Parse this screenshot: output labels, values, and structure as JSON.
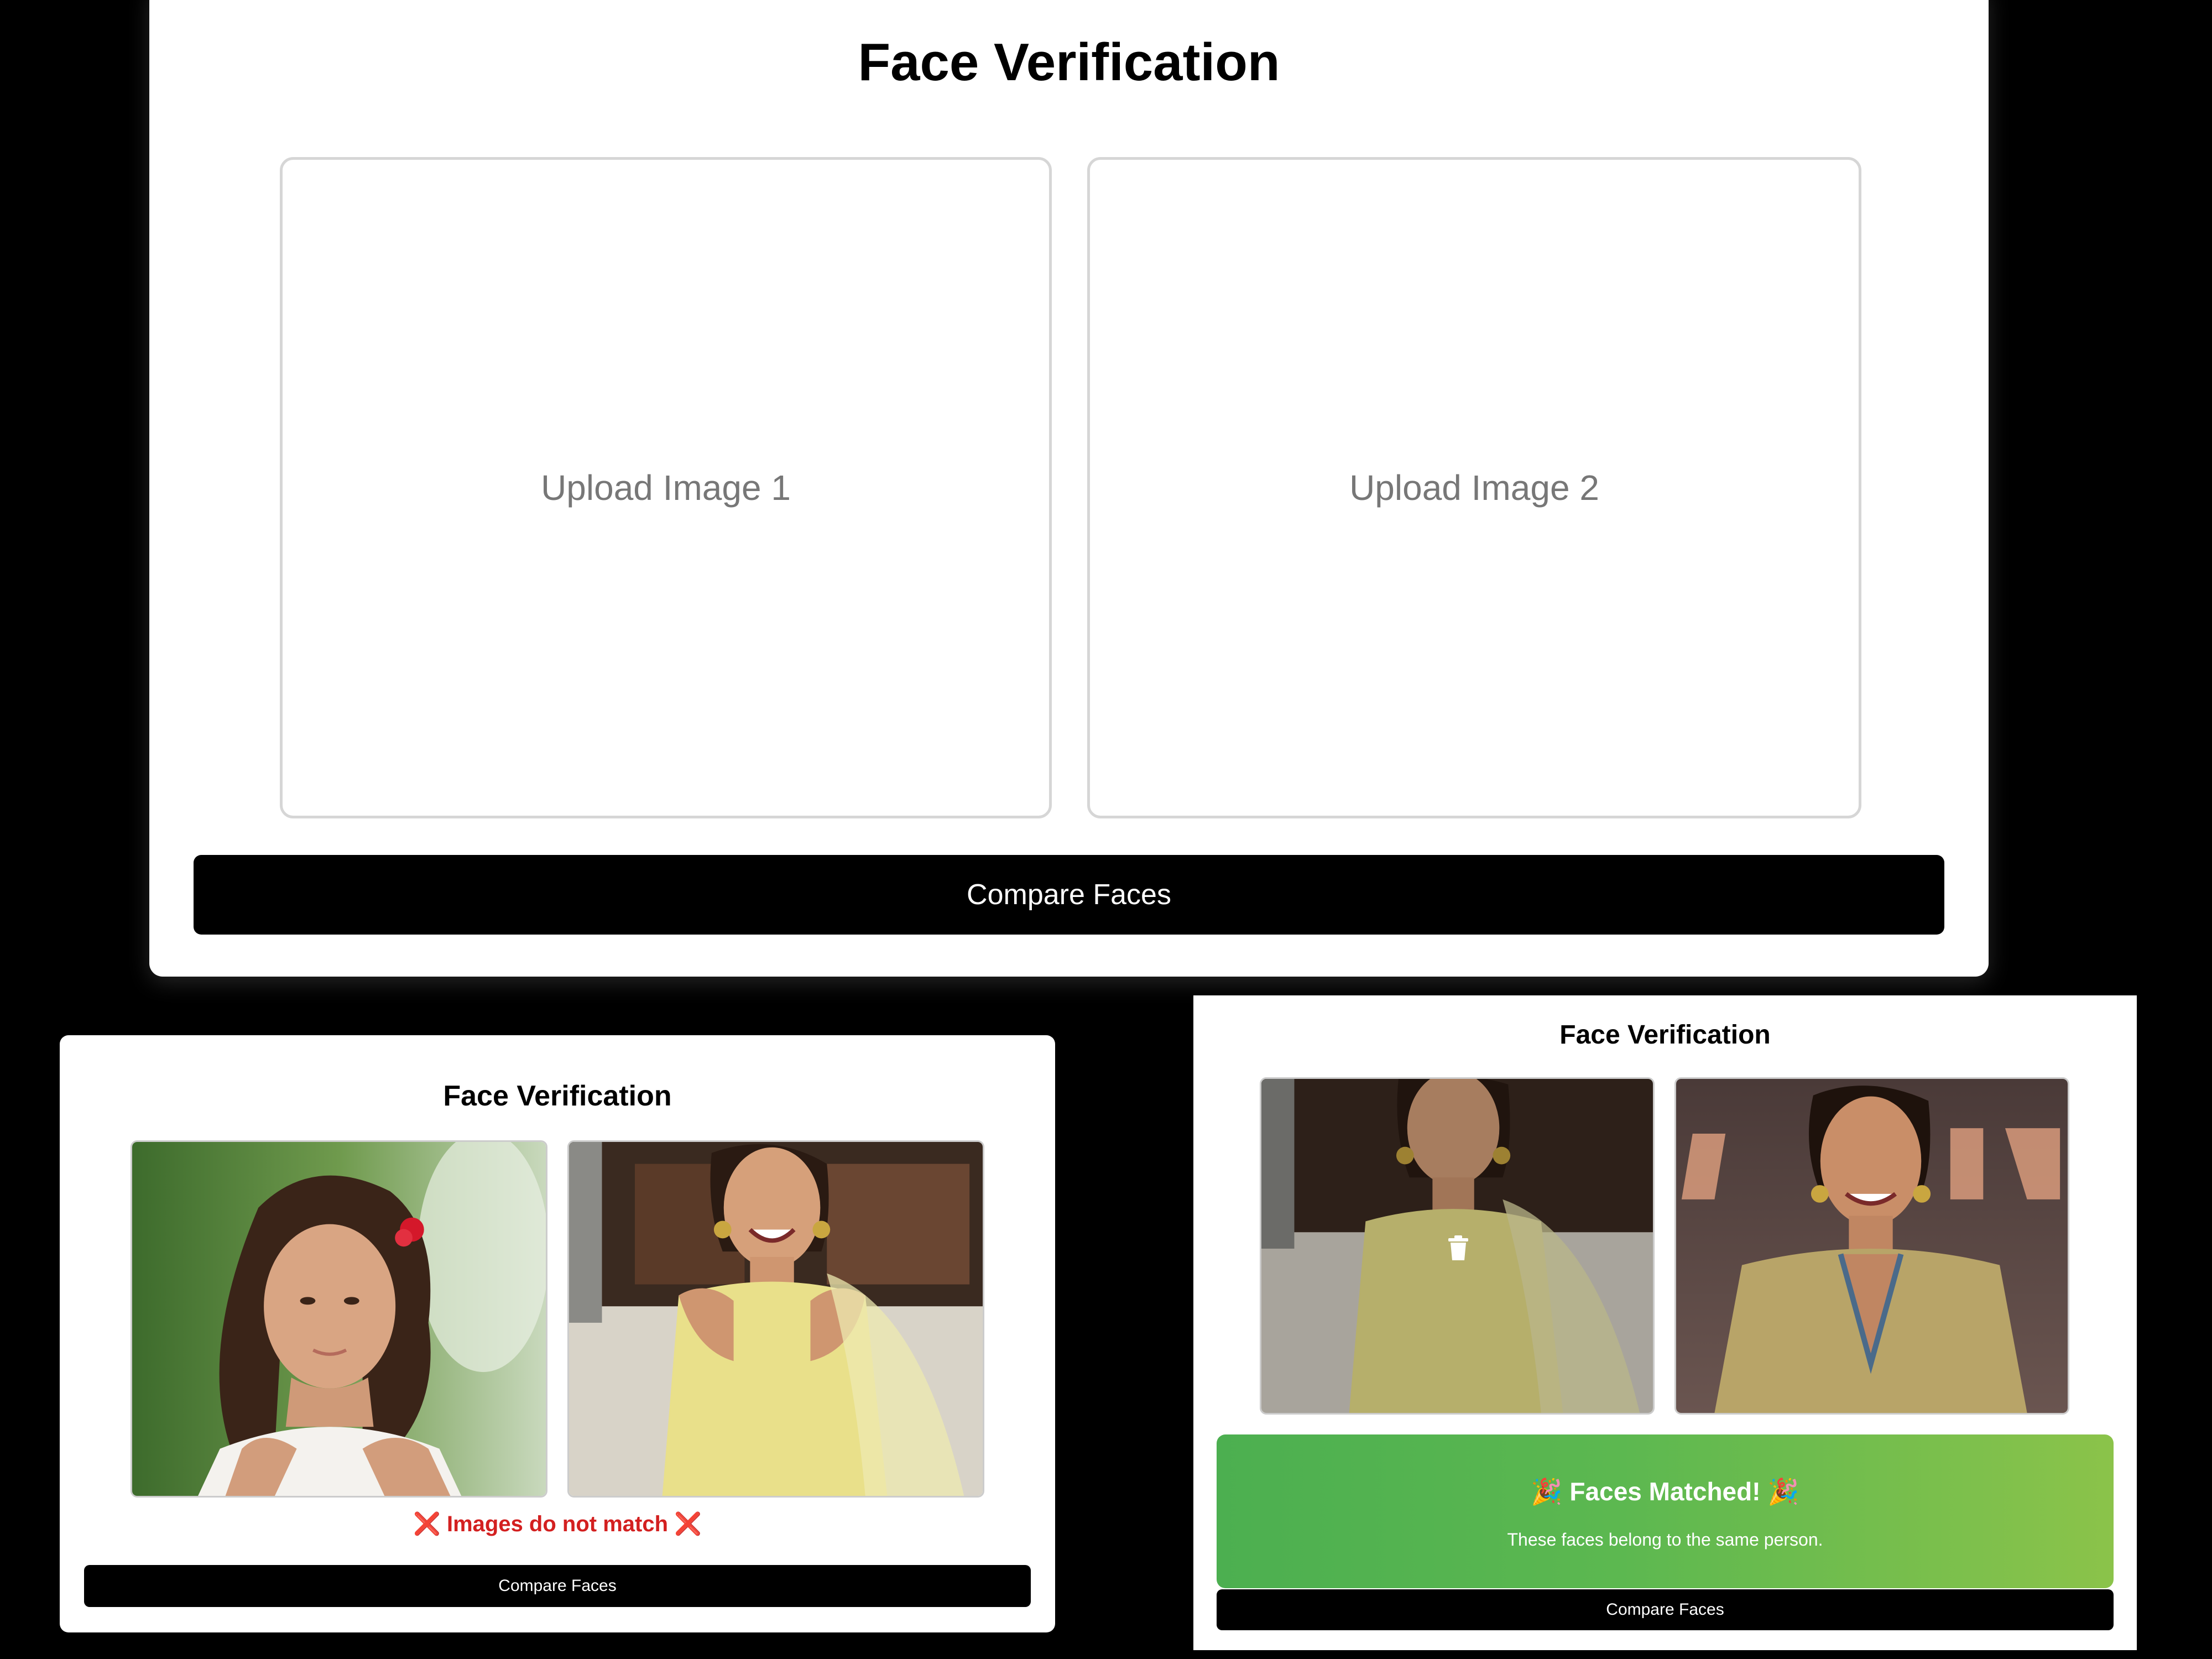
{
  "main": {
    "title": "Face Verification",
    "upload1": "Upload Image 1",
    "upload2": "Upload Image 2",
    "compare": "Compare Faces"
  },
  "mismatch_panel": {
    "title": "Face Verification",
    "result": "❌ Images do not match ❌",
    "compare": "Compare Faces"
  },
  "match_panel": {
    "title": "Face Verification",
    "result_title": "🎉 Faces Matched! 🎉",
    "result_sub": "These faces belong to the same person.",
    "compare": "Compare Faces",
    "delete_icon": "trash-icon"
  },
  "colors": {
    "button_bg": "#000000",
    "mismatch_text": "#d32020",
    "match_gradient_start": "#4caf50",
    "match_gradient_end": "#8bc34a"
  }
}
